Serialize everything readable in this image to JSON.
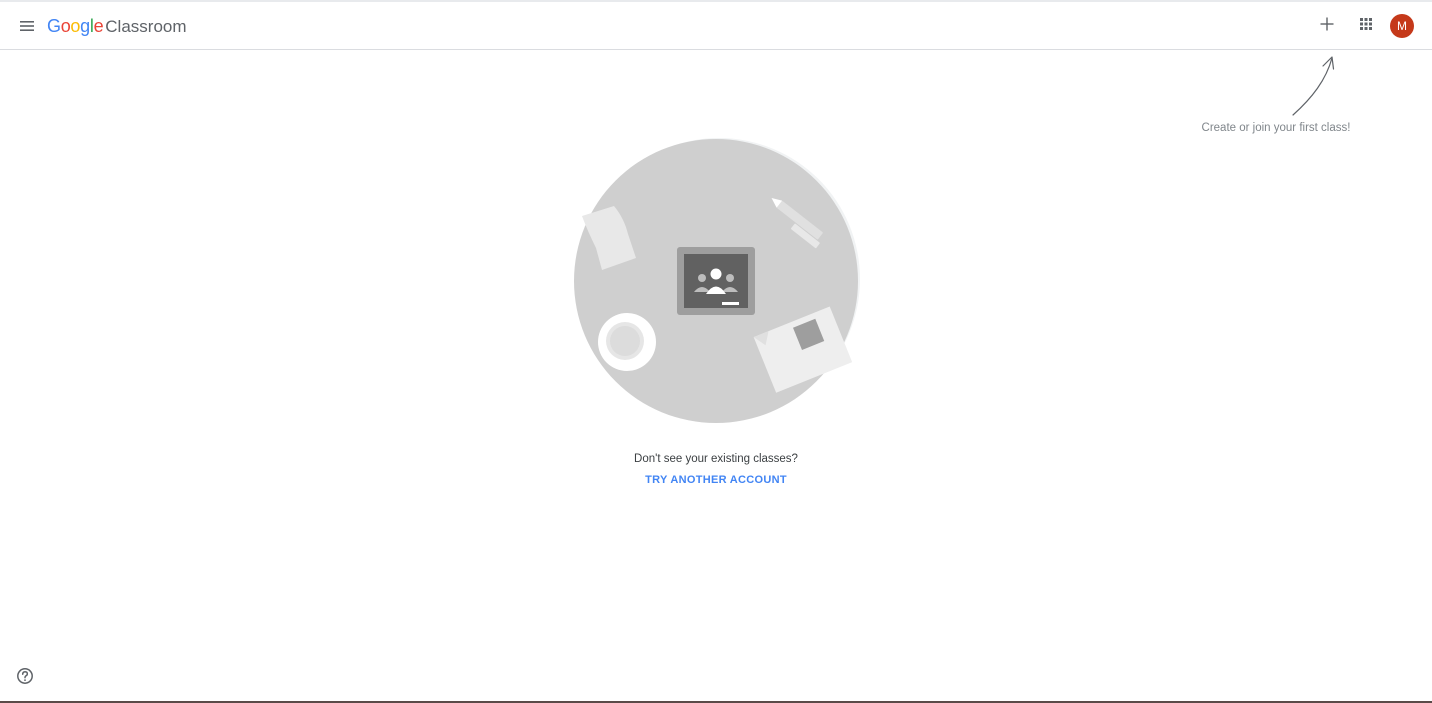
{
  "header": {
    "logo": {
      "letters": [
        {
          "ch": "G",
          "color": "#4285f4"
        },
        {
          "ch": "o",
          "color": "#ea4335"
        },
        {
          "ch": "o",
          "color": "#fbbc05"
        },
        {
          "ch": "g",
          "color": "#4285f4"
        },
        {
          "ch": "l",
          "color": "#34a853"
        },
        {
          "ch": "e",
          "color": "#ea4335"
        }
      ],
      "product": "Classroom"
    },
    "menu_icon": "hamburger-menu-icon",
    "plus_icon": "plus-icon",
    "apps_icon": "apps-grid-icon",
    "avatar_initial": "M",
    "avatar_color": "#c5391a"
  },
  "hint": {
    "text": "Create or join your first class!"
  },
  "empty_state": {
    "message": "Don't see your existing classes?",
    "link": "TRY ANOTHER ACCOUNT",
    "link_color": "#4285f4"
  },
  "footer": {
    "help_icon": "help-icon"
  }
}
